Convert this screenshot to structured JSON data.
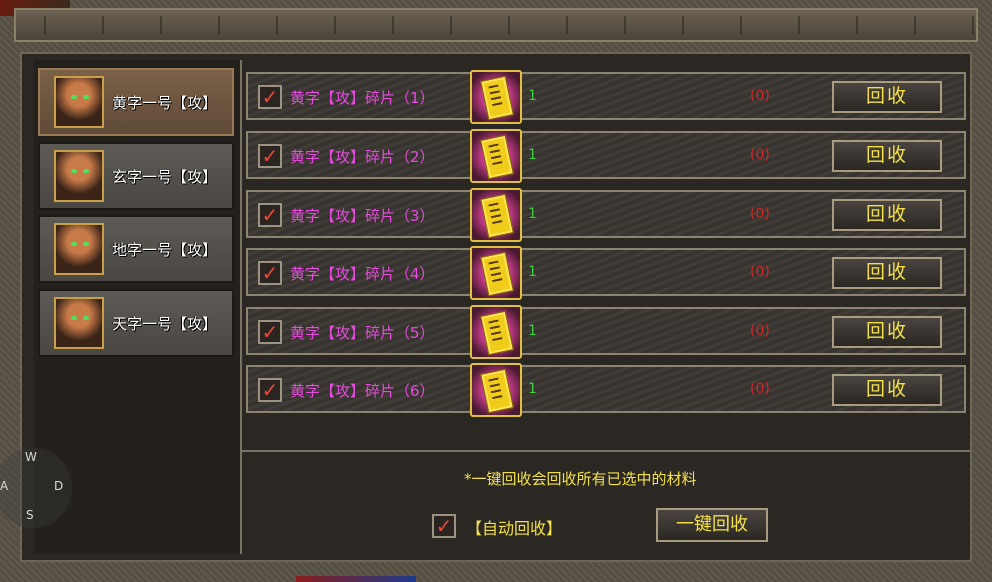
{
  "characters": [
    {
      "name": "黄字一号【攻】",
      "active": true
    },
    {
      "name": "玄字一号【攻】",
      "active": false
    },
    {
      "name": "地字一号【攻】",
      "active": false
    },
    {
      "name": "天字一号【攻】",
      "active": false
    }
  ],
  "items": [
    {
      "name": "黄字【攻】碎片（1）",
      "count": "1",
      "owned": "(0)",
      "button": "回收",
      "checked": true
    },
    {
      "name": "黄字【攻】碎片（2）",
      "count": "1",
      "owned": "(0)",
      "button": "回收",
      "checked": true
    },
    {
      "name": "黄字【攻】碎片（3）",
      "count": "1",
      "owned": "(0)",
      "button": "回收",
      "checked": true
    },
    {
      "name": "黄字【攻】碎片（4）",
      "count": "1",
      "owned": "(0)",
      "button": "回收",
      "checked": true
    },
    {
      "name": "黄字【攻】碎片（5）",
      "count": "1",
      "owned": "(0)",
      "button": "回收",
      "checked": true
    },
    {
      "name": "黄字【攻】碎片（6）",
      "count": "1",
      "owned": "(0)",
      "button": "回收",
      "checked": true
    }
  ],
  "footer": {
    "note": "*一键回收会回收所有已选中的材料",
    "auto_label": "【自动回收】",
    "auto_checked": true,
    "one_key_button": "一键回收"
  },
  "wasd": {
    "w": "W",
    "a": "A",
    "s": "S",
    "d": "D"
  },
  "icons": {
    "checkmark": "checkmark-icon",
    "item": "yellow-scroll-icon",
    "avatar": "warrior-portrait"
  },
  "colors": {
    "item_name": "#e84be0",
    "count": "#3fd03f",
    "owned": "#d82424",
    "button_text": "#f3e04a",
    "label_text": "#f3e04a"
  }
}
